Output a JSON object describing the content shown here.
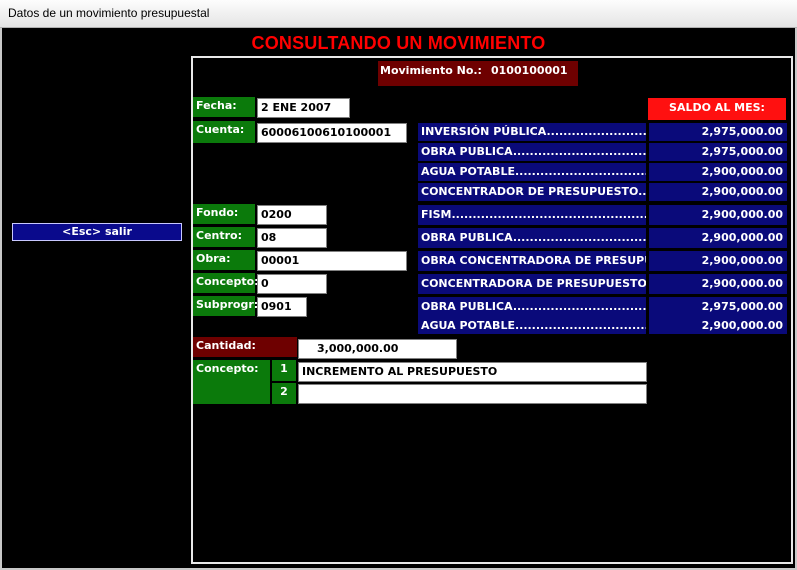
{
  "window": {
    "title": "Datos de un movimiento presupuestal"
  },
  "header": {
    "title": "CONSULTANDO UN MOVIMIENTO"
  },
  "movement": {
    "label": "Movimiento No.:",
    "number": "0100100001"
  },
  "esc_button": {
    "label": "<Esc> salir"
  },
  "fields": {
    "fecha": {
      "label": "Fecha:",
      "value": "2 ENE 2007"
    },
    "cuenta": {
      "label": "Cuenta:",
      "value": "60006100610100001"
    },
    "fondo": {
      "label": "Fondo:",
      "value": "0200"
    },
    "centro": {
      "label": "Centro:",
      "value": "08"
    },
    "obra": {
      "label": "Obra:",
      "value": "00001"
    },
    "concepto": {
      "label": "Concepto:",
      "value": "0"
    },
    "subprogr": {
      "label": "Subprogr:",
      "value": "0901"
    }
  },
  "saldo": {
    "header": "SALDO AL MES:",
    "rows": [
      {
        "name": "INVERSIÓN PÚBLICA...........................................",
        "amount": "2,975,000.00"
      },
      {
        "name": "OBRA PUBLICA.......................................................",
        "amount": "2,975,000.00"
      },
      {
        "name": "AGUA POTABLE......................................................",
        "amount": "2,900,000.00"
      },
      {
        "name": "CONCENTRADOR DE PRESUPUESTO.......................",
        "amount": "2,900,000.00"
      },
      {
        "name": "FISM.................................................................",
        "amount": "2,900,000.00"
      },
      {
        "name": "OBRA PUBLICA.......................................................",
        "amount": "2,900,000.00"
      },
      {
        "name": "OBRA CONCENTRADORA DE PRESUPUESTO",
        "amount": "2,900,000.00"
      },
      {
        "name": "CONCENTRADORA DE PRESUPUESTO......................",
        "amount": "2,900,000.00"
      },
      {
        "name": "OBRA PUBLICA.......................................................",
        "amount": "2,975,000.00"
      },
      {
        "name": "AGUA POTABLE......................................................",
        "amount": "2,900,000.00"
      }
    ]
  },
  "cantidad": {
    "label": "Cantidad:",
    "value": "3,000,000.00"
  },
  "concepto_text": {
    "label": "Concepto:",
    "lines": [
      {
        "num": "1",
        "text": "INCREMENTO AL PRESUPUESTO"
      },
      {
        "num": "2",
        "text": ""
      }
    ]
  },
  "colors": {
    "accent_red": "#ff0000",
    "label_green": "#0b7a0b",
    "row_blue": "#0a0a7a",
    "dark_red": "#6e0000"
  }
}
